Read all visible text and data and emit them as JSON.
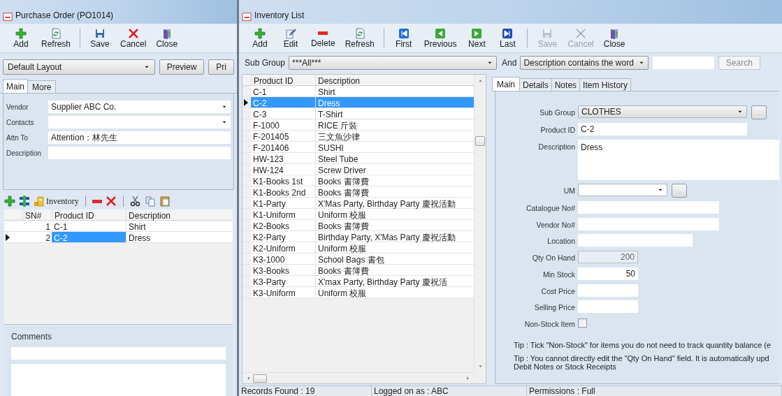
{
  "purchase_order": {
    "title": "Purchase Order (PO1014)",
    "toolbar": [
      [
        {
          "label": "Add",
          "kind": "add"
        },
        {
          "label": "Refresh",
          "kind": "refresh"
        }
      ],
      [
        {
          "label": "Save",
          "kind": "save"
        },
        {
          "label": "Cancel",
          "kind": "cancel"
        },
        {
          "label": "Close",
          "kind": "close"
        }
      ]
    ],
    "layout_select": "Default Layout",
    "buttons": [
      "Preview",
      "Pri"
    ],
    "tabs": [
      {
        "label": "Main",
        "selected": true
      },
      {
        "label": "More",
        "selected": false
      }
    ],
    "fields": [
      {
        "label": "Vendor",
        "value": "Supplier ABC Co.",
        "kind": "dropdown"
      },
      {
        "label": "Contacts",
        "kind": "dropdown"
      },
      {
        "label": "Attn To",
        "value": "Attention：林先生",
        "kind": "text"
      },
      {
        "label": "Description",
        "kind": "text"
      }
    ],
    "lines_toolbar": {
      "inventory_label": "Inventory"
    },
    "lines": {
      "columns": [
        "SN#",
        "Product ID",
        "Description"
      ],
      "rows": [
        {
          "sn": "1",
          "product_id": "C-1",
          "description": "Shirt",
          "selected": false
        },
        {
          "sn": "2",
          "product_id": "C-2",
          "description": "Dress",
          "selected": true
        }
      ]
    },
    "comments_label": "Comments"
  },
  "inventory": {
    "title": "Inventory List",
    "toolbar": [
      [
        {
          "label": "Add",
          "kind": "add",
          "disabled": false
        },
        {
          "label": "Edit",
          "kind": "edit",
          "disabled": false
        },
        {
          "label": "Delete",
          "kind": "delete",
          "disabled": false
        },
        {
          "label": "Refresh",
          "kind": "refresh",
          "disabled": false
        }
      ],
      [
        {
          "label": "First",
          "kind": "first",
          "disabled": false
        },
        {
          "label": "Previous",
          "kind": "previous",
          "disabled": false
        },
        {
          "label": "Next",
          "kind": "next",
          "disabled": false
        },
        {
          "label": "Last",
          "kind": "last",
          "disabled": false
        }
      ],
      [
        {
          "label": "Save",
          "kind": "save",
          "disabled": true
        },
        {
          "label": "Cancel",
          "kind": "cancel",
          "disabled": true
        },
        {
          "label": "Close",
          "kind": "close",
          "disabled": false
        }
      ]
    ],
    "filter": {
      "sub_group_label": "Sub Group",
      "sub_group_value": "***All***",
      "and_label": "And",
      "condition": "Description contains the word",
      "search_button": "Search"
    },
    "list": {
      "columns": [
        "Product ID",
        "Description"
      ],
      "rows": [
        {
          "product_id": "C-1",
          "description": "Shirt",
          "selected": false
        },
        {
          "product_id": "C-2",
          "description": "Dress",
          "selected": true
        },
        {
          "product_id": "C-3",
          "description": "T-Shirt",
          "selected": false
        },
        {
          "product_id": "F-1000",
          "description": "RICE 斤裝",
          "selected": false
        },
        {
          "product_id": "F-201405",
          "description": "三文魚沙律",
          "selected": false
        },
        {
          "product_id": "F-201406",
          "description": "SUSHI",
          "selected": false
        },
        {
          "product_id": "HW-123",
          "description": "Steel Tube",
          "selected": false
        },
        {
          "product_id": "HW-124",
          "description": "Screw Driver",
          "selected": false
        },
        {
          "product_id": "K1-Books 1st",
          "description": "Books 書簿費",
          "selected": false
        },
        {
          "product_id": "K1-Books 2nd",
          "description": "Books 書簿費",
          "selected": false
        },
        {
          "product_id": "K1-Party",
          "description": "X'Mas Party, Birthday Party 慶祝活動",
          "selected": false
        },
        {
          "product_id": "K1-Uniform",
          "description": "Uniform 校服",
          "selected": false
        },
        {
          "product_id": "K2-Books",
          "description": "Books  書簿費",
          "selected": false
        },
        {
          "product_id": "K2-Party",
          "description": "Birthday Party, X'Mas Party 慶祝活動",
          "selected": false
        },
        {
          "product_id": "K2-Uniform",
          "description": "Uniform 校服",
          "selected": false
        },
        {
          "product_id": "K3-1000",
          "description": "School Bags 書包",
          "selected": false
        },
        {
          "product_id": "K3-Books",
          "description": "Books  書簿費",
          "selected": false
        },
        {
          "product_id": "K3-Party",
          "description": "X'max Party, Birthday Party 慶祝活",
          "selected": false
        },
        {
          "product_id": "K3-Uniform",
          "description": "Uniform 校服",
          "selected": false
        }
      ]
    },
    "detail": {
      "tabs": [
        {
          "label": "Main",
          "selected": true
        },
        {
          "label": "Details",
          "selected": false
        },
        {
          "label": "Notes",
          "selected": false
        },
        {
          "label": "Item History",
          "selected": false
        }
      ],
      "fields": [
        {
          "label": "Sub Group",
          "value": "CLOTHES",
          "kind": "dropdown"
        },
        {
          "label": "Product ID",
          "value": "C-2",
          "kind": "text"
        },
        {
          "label": "Description",
          "value": "Dress",
          "kind": "textarea"
        },
        {
          "label": "UM",
          "kind": "dropdown"
        },
        {
          "label": "Catalogue No#",
          "kind": "text"
        },
        {
          "label": "Vendor No#",
          "kind": "text"
        },
        {
          "label": "Location",
          "kind": "text"
        },
        {
          "label": "Qty On Hand",
          "value": "200",
          "kind": "readonly_number"
        },
        {
          "label": "Min Stock",
          "value": "50",
          "kind": "number"
        },
        {
          "label": "Cost Price",
          "kind": "number"
        },
        {
          "label": "Selling Price",
          "kind": "number"
        },
        {
          "label": "Non-Stock Item",
          "kind": "checkbox",
          "checked": false
        }
      ],
      "tips": [
        [
          "Tip : Tick \"Non-Stock\" for items you do not need to track quantity balance (e"
        ],
        [
          "Tip : You cannot directly edit the \"Qty On Hand\" field. It is automatically upd",
          "Debit Notes or Stock Receipts"
        ]
      ]
    },
    "status_bar": [
      "Records Found : 19",
      "Logged on as : ABC",
      "Permissions : Full"
    ]
  }
}
